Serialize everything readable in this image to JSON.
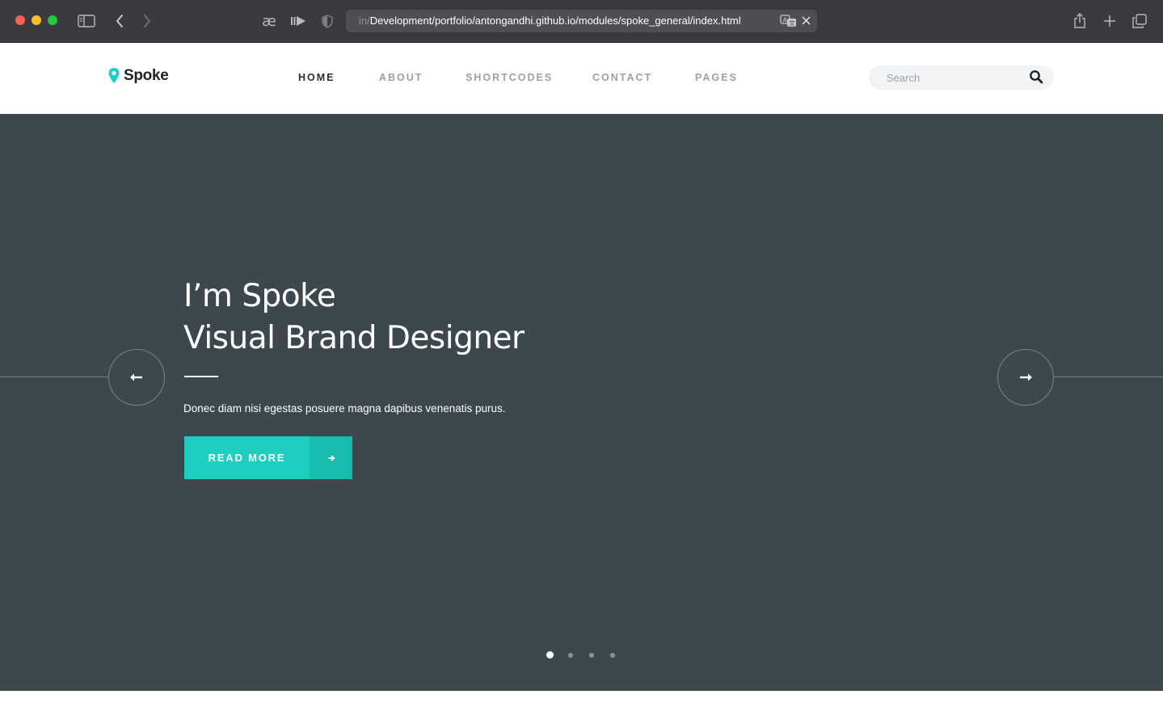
{
  "browser": {
    "url_prefix": "in/",
    "url_main": "Development/portfolio/antongandhi.github.io/modules/spoke_general/index.html",
    "icons": [
      "sidebar-icon",
      "back-icon",
      "forward-icon",
      "ae-icon",
      "reader-icon",
      "shield-icon",
      "translate-icon",
      "clear-icon",
      "share-icon",
      "new-tab-icon",
      "tabs-overview-icon"
    ],
    "ae_label": "æ"
  },
  "site": {
    "logo_text": "Spoke",
    "nav": [
      {
        "label": "HOME",
        "active": true
      },
      {
        "label": "ABOUT",
        "active": false
      },
      {
        "label": "SHORTCODES",
        "active": false
      },
      {
        "label": "CONTACT",
        "active": false
      },
      {
        "label": "PAGES",
        "active": false
      }
    ],
    "search": {
      "placeholder": "Search"
    }
  },
  "hero": {
    "title_line1": "I’m Spoke",
    "title_line2": "Visual Brand Designer",
    "subtitle": "Donec diam nisi egestas posuere magna dapibus venenatis purus.",
    "cta_label": "READ MORE",
    "slides_total": 4,
    "active_slide": 1
  },
  "colors": {
    "accent": "#1ccfc1",
    "accent_dark": "#17bcaf",
    "hero_bg": "#3d474e",
    "logo_pin": "#1ccfc1"
  }
}
